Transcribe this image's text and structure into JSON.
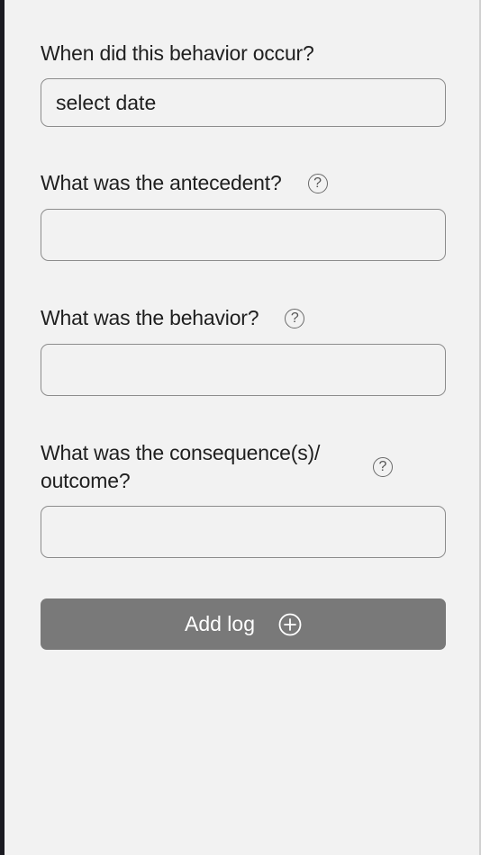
{
  "form": {
    "date": {
      "label": "When did this behavior occur?",
      "value": "select date"
    },
    "antecedent": {
      "label": "What was the antecedent?",
      "value": "",
      "help_icon": "question-circle-icon",
      "help_glyph": "?"
    },
    "behavior": {
      "label": "What was the behavior?",
      "value": "",
      "help_icon": "question-circle-icon",
      "help_glyph": "?"
    },
    "consequence": {
      "label_line1": "What was the consequence(s)/",
      "label_line2": "outcome?",
      "value": "",
      "help_icon": "question-circle-icon",
      "help_glyph": "?"
    },
    "submit": {
      "label": "Add log",
      "icon": "plus-circle-icon"
    }
  },
  "colors": {
    "background": "#f2f2f2",
    "button_bg": "#797979",
    "button_text": "#ffffff",
    "field_border": "#8c8c8c",
    "text": "#1f1f1f"
  }
}
